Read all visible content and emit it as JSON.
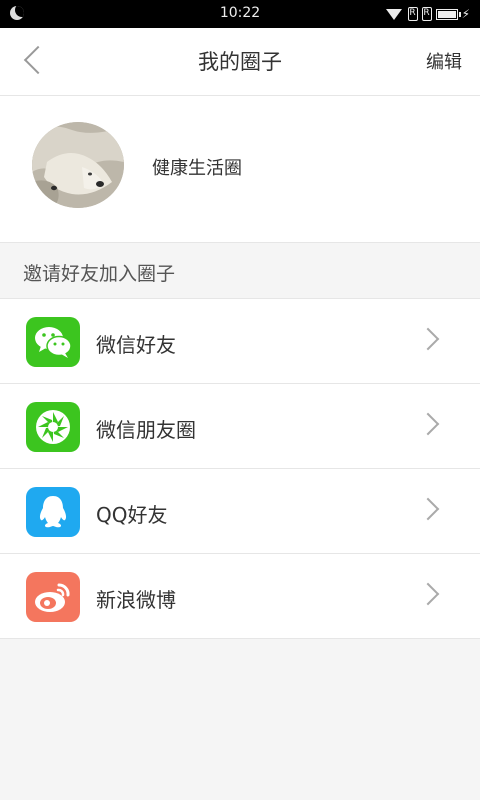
{
  "status_bar": {
    "time": "10:22"
  },
  "header": {
    "title": "我的圈子",
    "edit_label": "编辑"
  },
  "profile": {
    "circle_name": "健康生活圈"
  },
  "invite": {
    "section_title": "邀请好友加入圈子",
    "items": [
      {
        "label": "微信好友",
        "icon": "wechat-icon",
        "color": "#3cc51f"
      },
      {
        "label": "微信朋友圈",
        "icon": "wechat-moments-icon",
        "color": "#3cc51f"
      },
      {
        "label": "QQ好友",
        "icon": "qq-icon",
        "color": "#1fa9f0"
      },
      {
        "label": "新浪微博",
        "icon": "weibo-icon",
        "color": "#f4765e"
      }
    ]
  }
}
